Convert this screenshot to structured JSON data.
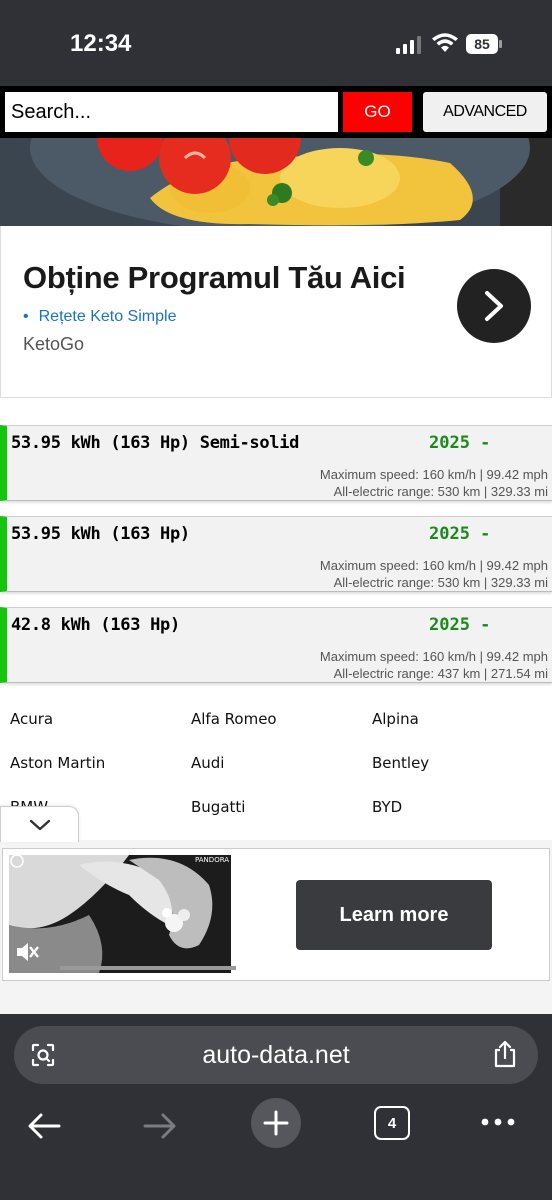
{
  "status_bar": {
    "time": "12:34",
    "battery": "85"
  },
  "search": {
    "placeholder": "Search...",
    "go_label": "GO",
    "advanced_label": "ADVANCED"
  },
  "ad_top": {
    "title": "Obține Programul Tău Aici",
    "link": "Rețete Keto Simple",
    "brand": "KetoGo",
    "icons": [
      "food-photo",
      "arrow-right-icon"
    ]
  },
  "versions": [
    {
      "name": "53.95 kWh (163 Hp) Semi-solid",
      "year": "2025 -",
      "speed": "Maximum speed: 160 km/h | 99.42 mph",
      "range": "All-electric range: 530 km | 329.33 mi"
    },
    {
      "name": "53.95 kWh (163 Hp)",
      "year": "2025 -",
      "speed": "Maximum speed: 160 km/h | 99.42 mph",
      "range": "All-electric range: 530 km | 329.33 mi"
    },
    {
      "name": "42.8 kWh (163 Hp)",
      "year": "2025 -",
      "speed": "Maximum speed: 160 km/h | 99.42 mph",
      "range": "All-electric range: 437 km | 271.54 mi"
    }
  ],
  "brands": [
    "Acura",
    "Alfa Romeo",
    "Alpina",
    "Aston Martin",
    "Audi",
    "Bentley",
    "BMW",
    "Bugatti",
    "BYD"
  ],
  "ad_bottom": {
    "brand_watermark": "PANDORA",
    "cta": "Learn more"
  },
  "browser": {
    "url": "auto-data.net",
    "tab_count": "4"
  },
  "colors": {
    "accent_green": "#15c40c",
    "year_green": "#1a8a1a",
    "go_red": "#ff0000",
    "link_blue": "#1a73c9",
    "chrome_bg": "#2f3136"
  }
}
